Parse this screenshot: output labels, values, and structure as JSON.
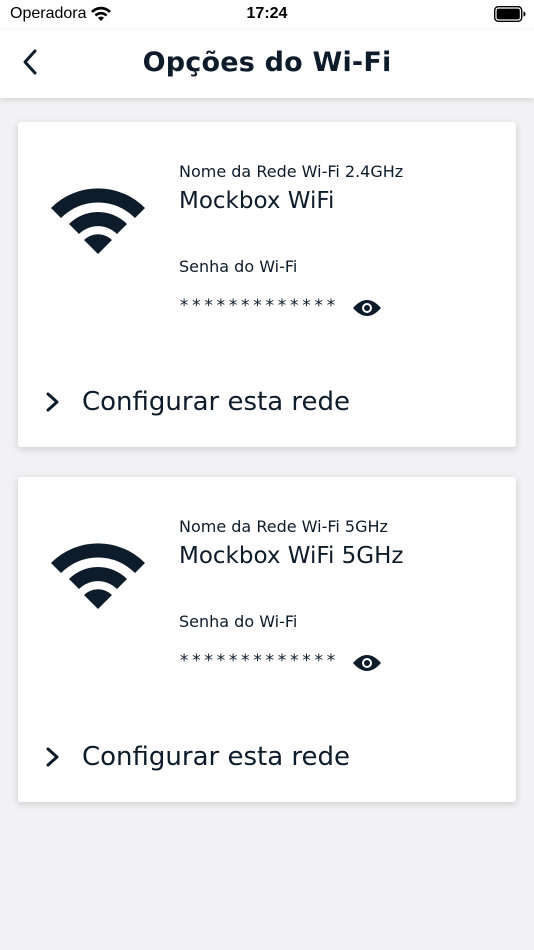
{
  "status_bar": {
    "carrier": "Operadora",
    "time": "17:24"
  },
  "header": {
    "title": "Opções do Wi-Fi"
  },
  "networks": [
    {
      "label": "Nome da Rede Wi-Fi 2.4GHz",
      "name": "Mockbox WiFi",
      "password_label": "Senha do Wi-Fi",
      "password_masked": "*************",
      "configure_label": "Configurar esta rede"
    },
    {
      "label": "Nome da Rede Wi-Fi 5GHz",
      "name": "Mockbox WiFi 5GHz",
      "password_label": "Senha do Wi-Fi",
      "password_masked": "*************",
      "configure_label": "Configurar esta rede"
    }
  ],
  "colors": {
    "primary_text": "#0d1b2a",
    "background": "#f2f2f4",
    "card": "#ffffff"
  },
  "icons": {
    "back": "chevron-left-icon",
    "wifi": "wifi-icon",
    "eye": "eye-icon",
    "configure": "chevron-right-icon"
  }
}
